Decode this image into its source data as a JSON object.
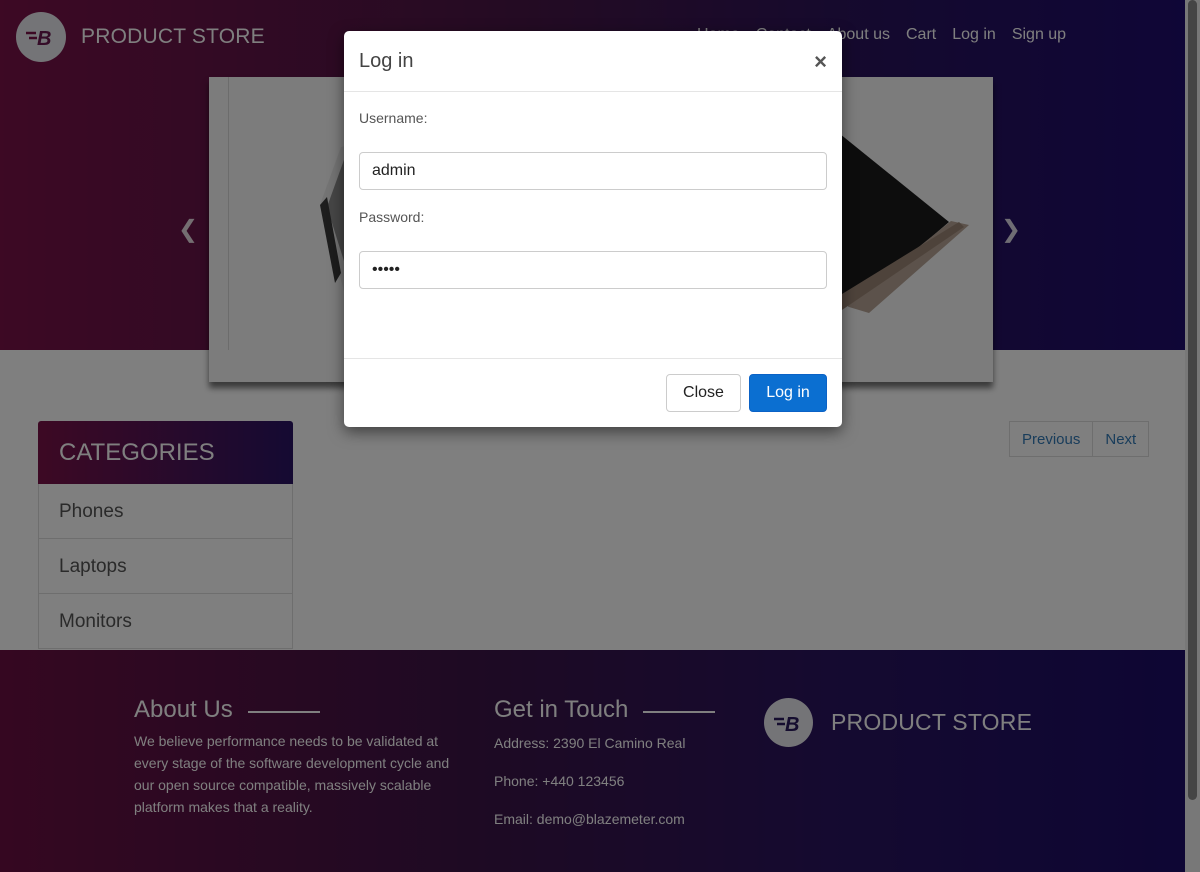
{
  "brand": {
    "name": "PRODUCT STORE",
    "logo_letter": "B"
  },
  "nav": {
    "items": [
      "Home",
      "Contact",
      "About us",
      "Cart",
      "Log in",
      "Sign up"
    ]
  },
  "carousel": {
    "prev_icon": "chevron-left-icon",
    "next_icon": "chevron-right-icon"
  },
  "categories": {
    "title": "CATEGORIES",
    "items": [
      "Phones",
      "Laptops",
      "Monitors"
    ]
  },
  "pagination": {
    "previous": "Previous",
    "next": "Next"
  },
  "footer": {
    "about": {
      "title": "About Us",
      "text": "We believe performance needs to be validated at every stage of the software development cycle and our open source compatible, massively scalable platform makes that a reality."
    },
    "contact": {
      "title": "Get in Touch",
      "address": "Address: 2390 El Camino Real",
      "phone": "Phone: +440 123456",
      "email": "Email: demo@blazemeter.com"
    },
    "brand_name": "PRODUCT STORE"
  },
  "modal": {
    "title": "Log in",
    "close_symbol": "×",
    "username_label": "Username:",
    "username_value": "admin",
    "password_label": "Password:",
    "password_value": "•••••",
    "close_button": "Close",
    "login_button": "Log in"
  },
  "colors": {
    "primary_button": "#0b6fd1",
    "gradient_start": "#7a1248",
    "gradient_end": "#1f0c6e"
  }
}
